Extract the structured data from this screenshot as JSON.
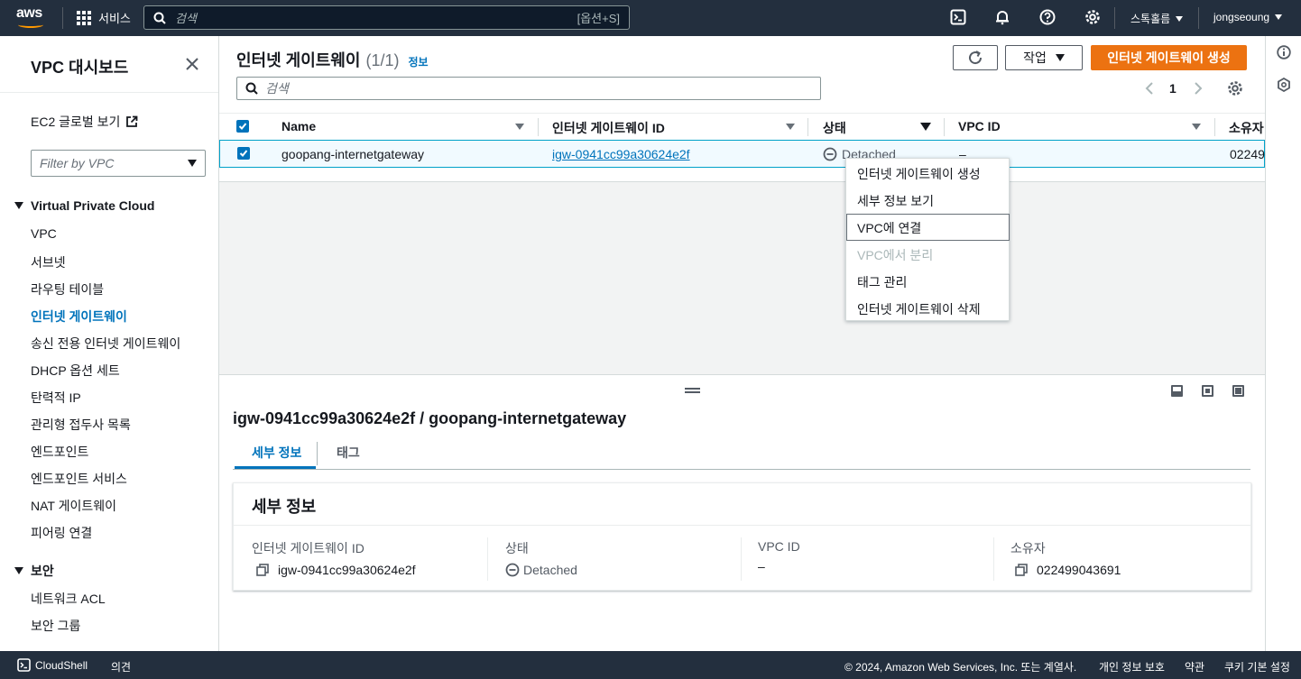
{
  "topnav": {
    "logo": "aws",
    "services_label": "서비스",
    "search_placeholder": "검색",
    "search_shortcut": "[옵션+S]",
    "region_label": "스톡홀름",
    "user_label": "jongseoung"
  },
  "sidebar": {
    "title": "VPC 대시보드",
    "ec2_link": "EC2 글로벌 보기",
    "filter_placeholder": "Filter by VPC",
    "section_vpc": "Virtual Private Cloud",
    "vpc_items": [
      "VPC",
      "서브넷",
      "라우팅 테이블",
      "인터넷 게이트웨이",
      "송신 전용 인터넷 게이트웨이",
      "DHCP 옵션 세트",
      "탄력적 IP",
      "관리형 접두사 목록",
      "엔드포인트",
      "엔드포인트 서비스",
      "NAT 게이트웨이",
      "피어링 연결"
    ],
    "section_security": "보안",
    "security_items": [
      "네트워크 ACL",
      "보안 그룹"
    ]
  },
  "main": {
    "title": "인터넷 게이트웨이",
    "count": "(1/1)",
    "info": "정보",
    "actions_label": "작업",
    "create_label": "인터넷 게이트웨이 생성",
    "search_placeholder": "검색",
    "page_number": "1",
    "columns": [
      "Name",
      "인터넷 게이트웨이 ID",
      "상태",
      "VPC ID",
      "소유자"
    ],
    "row": {
      "name": "goopang-internetgateway",
      "id": "igw-0941cc99a30624e2f",
      "status": "Detached",
      "vpc_id": "–",
      "owner": "02249"
    }
  },
  "dropdown": {
    "items": [
      "인터넷 게이트웨이 생성",
      "세부 정보 보기",
      "VPC에 연결",
      "VPC에서 분리",
      "태그 관리",
      "인터넷 게이트웨이 삭제"
    ]
  },
  "split": {
    "title": "igw-0941cc99a30624e2f / goopang-internetgateway",
    "tabs": [
      "세부 정보",
      "태그"
    ],
    "card_title": "세부 정보",
    "fields": [
      {
        "label": "인터넷 게이트웨이 ID",
        "value": "igw-0941cc99a30624e2f"
      },
      {
        "label": "상태",
        "value": "Detached"
      },
      {
        "label": "VPC ID",
        "value": "–"
      },
      {
        "label": "소유자",
        "value": "022499043691"
      }
    ]
  },
  "footer": {
    "cloudshell": "CloudShell",
    "feedback": "의견",
    "copyright": "© 2024, Amazon Web Services, Inc. 또는 계열사.",
    "privacy": "개인 정보 보호",
    "terms": "약관",
    "cookies": "쿠키 기본 설정"
  },
  "colors": {
    "nav_bg": "#232f3e",
    "primary": "#ec7211",
    "link": "#0073bb"
  }
}
